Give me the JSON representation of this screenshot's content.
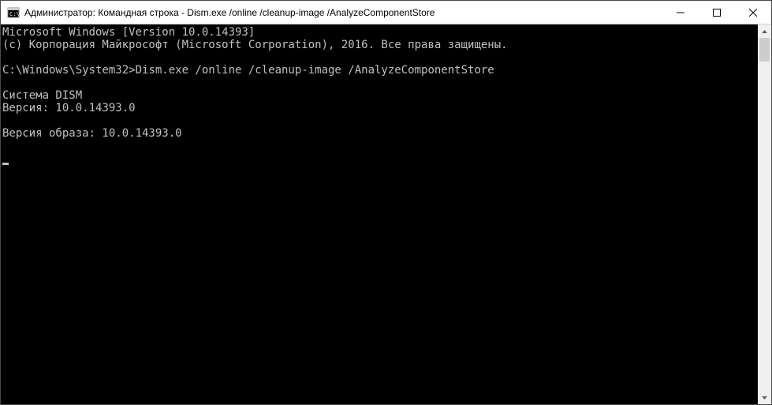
{
  "window": {
    "title": "Администратор: Командная строка - Dism.exe  /online /cleanup-image /AnalyzeComponentStore"
  },
  "terminal": {
    "lines": [
      "Microsoft Windows [Version 10.0.14393]",
      "(c) Корпорация Майкрософт (Microsoft Corporation), 2016. Все права защищены.",
      "",
      "C:\\Windows\\System32>Dism.exe /online /cleanup-image /AnalyzeComponentStore",
      "",
      "Cистема DISM",
      "Версия: 10.0.14393.0",
      "",
      "Версия образа: 10.0.14393.0",
      "",
      ""
    ]
  }
}
